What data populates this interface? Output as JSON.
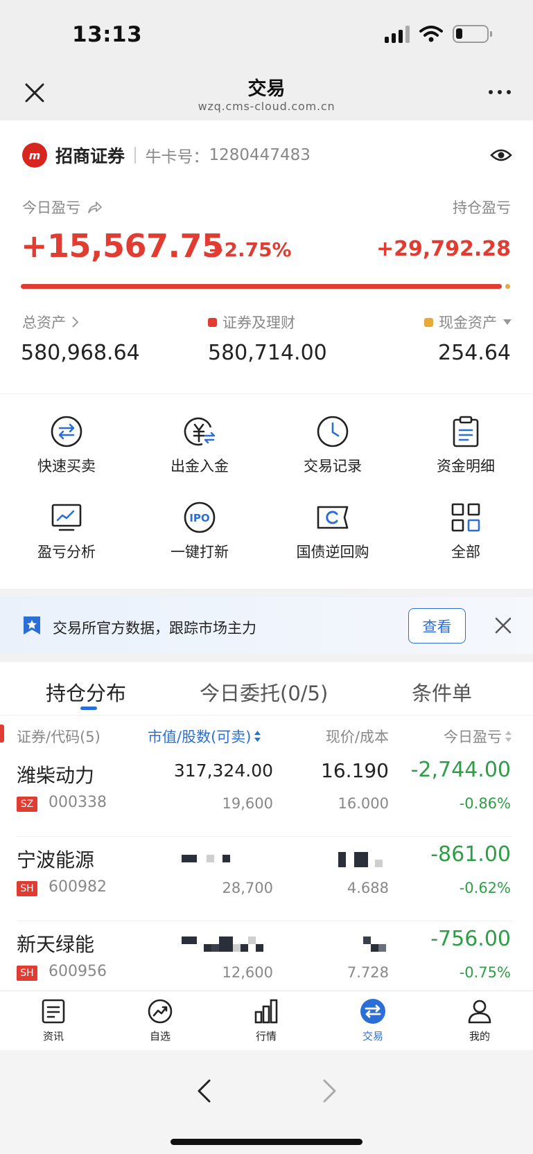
{
  "status": {
    "time": "13:13"
  },
  "nav": {
    "title": "交易",
    "url": "wzq.cms-cloud.com.cn"
  },
  "account": {
    "brand": "招商证券",
    "card_label": "牛卡号：",
    "card_no": "1280447483"
  },
  "summary": {
    "today_pnl_label": "今日盈亏",
    "today_pnl": "+15,567.75",
    "today_pct": "+2.75%",
    "holding_pnl_label": "持仓盈亏",
    "holding_pnl": "+29,792.28",
    "securities_share": 0.9996,
    "total_label": "总资产",
    "total_value": "580,968.64",
    "securities_label": "证券及理财",
    "securities_value": "580,714.00",
    "cash_label": "现金资产",
    "cash_value": "254.64",
    "colors": {
      "securities": "#e03c31",
      "cash": "#e6a93a"
    }
  },
  "quick_actions": [
    {
      "label": "快速买卖",
      "icon": "swap-icon"
    },
    {
      "label": "出金入金",
      "icon": "yuan-transfer-icon"
    },
    {
      "label": "交易记录",
      "icon": "clock-icon"
    },
    {
      "label": "资金明细",
      "icon": "clipboard-icon"
    },
    {
      "label": "盈亏分析",
      "icon": "chart-monitor-icon"
    },
    {
      "label": "一键打新",
      "icon": "ipo-icon"
    },
    {
      "label": "国债逆回购",
      "icon": "bond-ticket-icon"
    },
    {
      "label": "全部",
      "icon": "grid-icon"
    }
  ],
  "banner": {
    "text": "交易所官方数据，跟踪市场主力",
    "button": "查看"
  },
  "holdings": {
    "tabs": [
      "持仓分布",
      "今日委托(0/5)",
      "条件单"
    ],
    "columns": [
      "证券/代码(5)",
      "市值/股数(可卖)",
      "现价/成本",
      "今日盈亏"
    ],
    "rows": [
      {
        "name": "潍柴动力",
        "market": "SZ",
        "code": "000338",
        "value": "317,324.00",
        "shares": "19,600",
        "price": "16.190",
        "cost": "16.000",
        "pnl": "-2,744.00",
        "pct": "-0.86%"
      },
      {
        "name": "宁波能源",
        "market": "SH",
        "code": "600982",
        "value": "",
        "shares": "28,700",
        "price": "",
        "cost": "4.688",
        "pnl": "-861.00",
        "pct": "-0.62%"
      },
      {
        "name": "新天绿能",
        "market": "SH",
        "code": "600956",
        "value": "",
        "shares": "12,600",
        "price": "",
        "cost": "7.728",
        "pnl": "-756.00",
        "pct": "-0.75%"
      }
    ]
  },
  "tabbar": [
    {
      "label": "资讯",
      "icon": "news-icon"
    },
    {
      "label": "自选",
      "icon": "trend-icon"
    },
    {
      "label": "行情",
      "icon": "bar-chart-icon"
    },
    {
      "label": "交易",
      "icon": "trade-icon",
      "active": true
    },
    {
      "label": "我的",
      "icon": "user-icon"
    }
  ]
}
